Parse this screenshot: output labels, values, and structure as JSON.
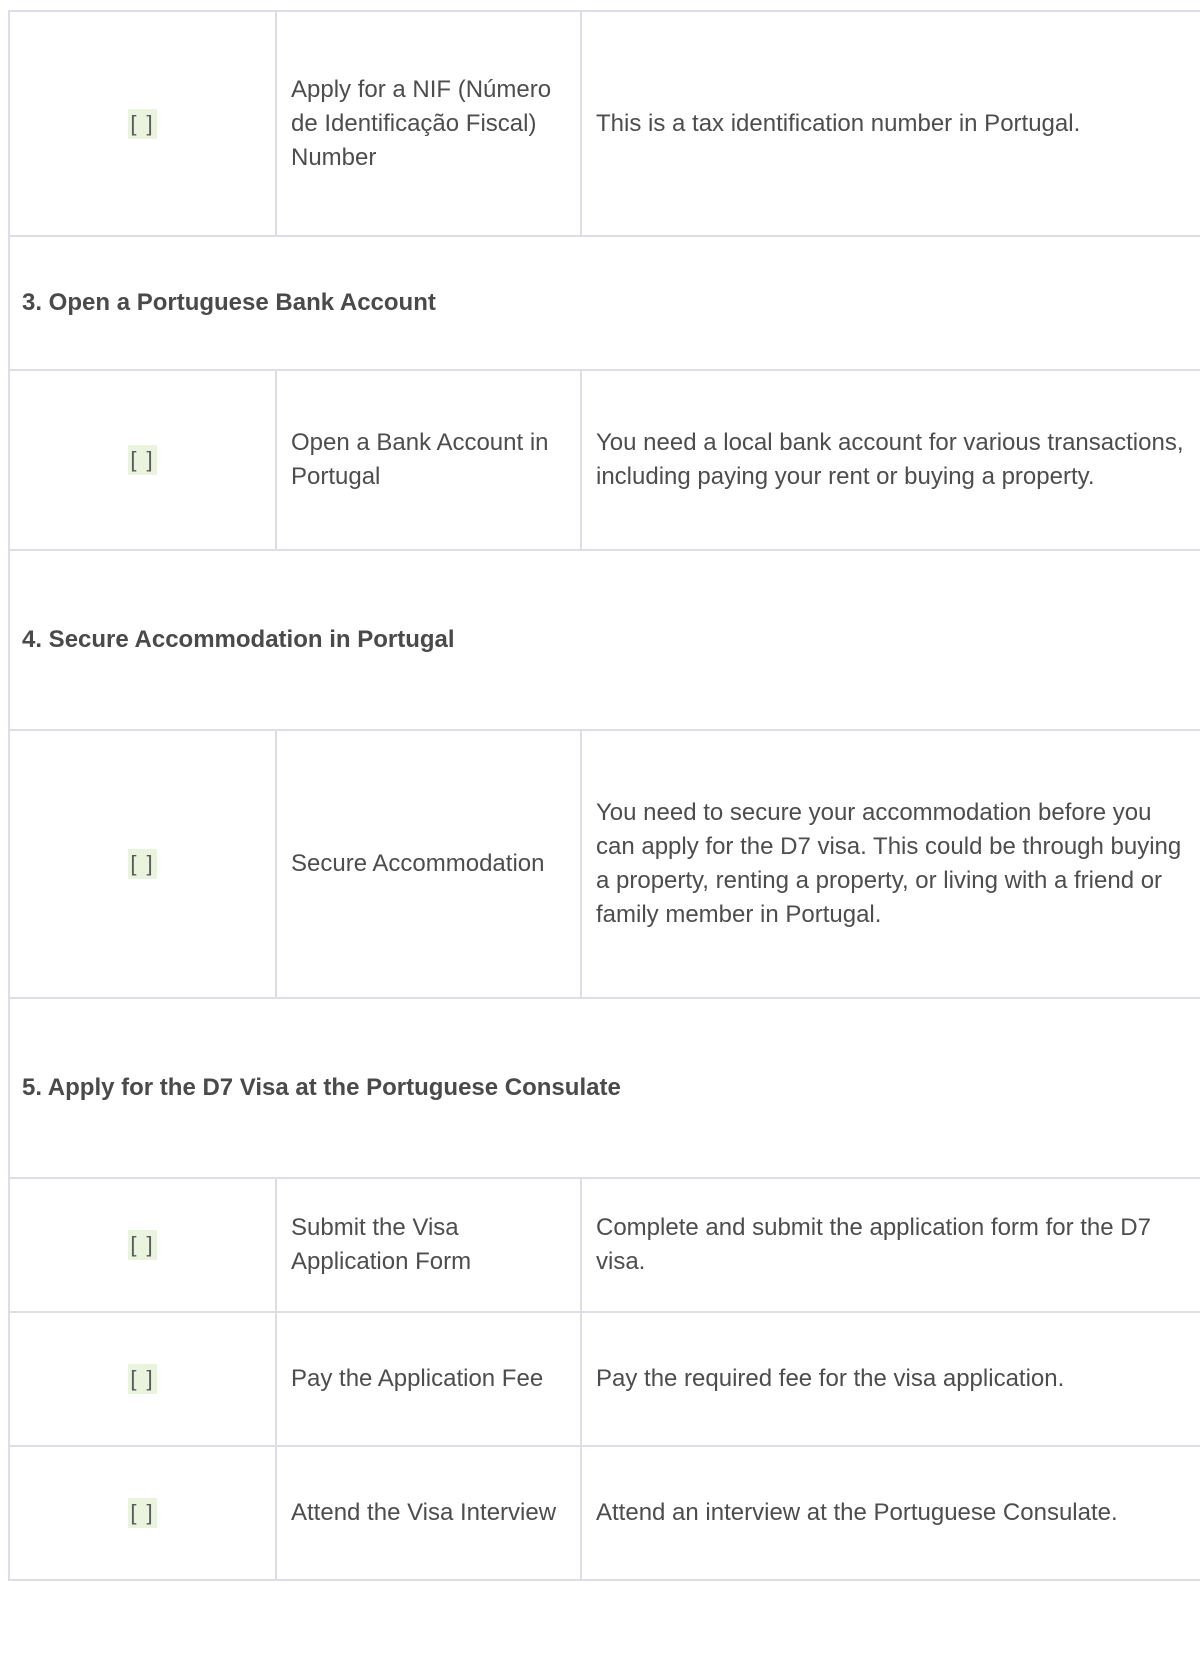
{
  "checkbox_text": "[ ]",
  "rows": [
    {
      "type": "task",
      "task": "Apply for a NIF (Número de Identificação Fiscal) Number",
      "description": "This is a tax identification number in Portugal."
    },
    {
      "type": "section",
      "heading": "3. Open a Portuguese Bank Account"
    },
    {
      "type": "task",
      "task": "Open a Bank Account in Portugal",
      "description": "You need a local bank account for various transactions, including paying your rent or buying a property."
    },
    {
      "type": "section",
      "heading": "4. Secure Accommodation in Portugal"
    },
    {
      "type": "task",
      "task": "Secure Accommodation",
      "description": "You need to secure your accommodation before you can apply for the D7 visa. This could be through buying a property, renting a property, or living with a friend or family member in Portugal."
    },
    {
      "type": "section",
      "heading": "5. Apply for the D7 Visa at the Portuguese Consulate"
    },
    {
      "type": "task",
      "task": "Submit the Visa Application Form",
      "description": "Complete and submit the application form for the D7 visa."
    },
    {
      "type": "task",
      "task": "Pay the Application Fee",
      "description": "Pay the required fee for the visa application."
    },
    {
      "type": "task",
      "task": "Attend the Visa Interview",
      "description": "Attend an interview at the Portuguese Consulate."
    }
  ]
}
